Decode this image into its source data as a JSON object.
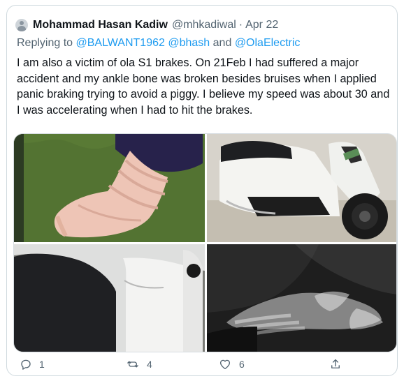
{
  "tweet": {
    "author_name": "Mohammad Hasan Kadiw",
    "handle": "@mhkadiwal",
    "separator": "·",
    "date": "Apr 22",
    "replying_prefix": "Replying to",
    "mentions": [
      "@BALWANT1962",
      "@bhash",
      "and",
      "@OlaElectric"
    ],
    "text": "I am also a victim of ola S1 brakes. On 21Feb I had suffered a major accident and my ankle bone was broken besides bruises when I applied panic braking trying to avoid a piggy. I believe my speed was about 30 and I was accelerating when I had to hit the brakes."
  },
  "actions": {
    "reply_count": "1",
    "retweet_count": "4",
    "like_count": "6"
  },
  "icons": {
    "reply": "reply-icon",
    "retweet": "retweet-icon",
    "like": "heart-icon",
    "share": "share-icon"
  },
  "colors": {
    "link": "#1d9bf0",
    "secondary_text": "#536471",
    "border": "#cfd9de"
  }
}
